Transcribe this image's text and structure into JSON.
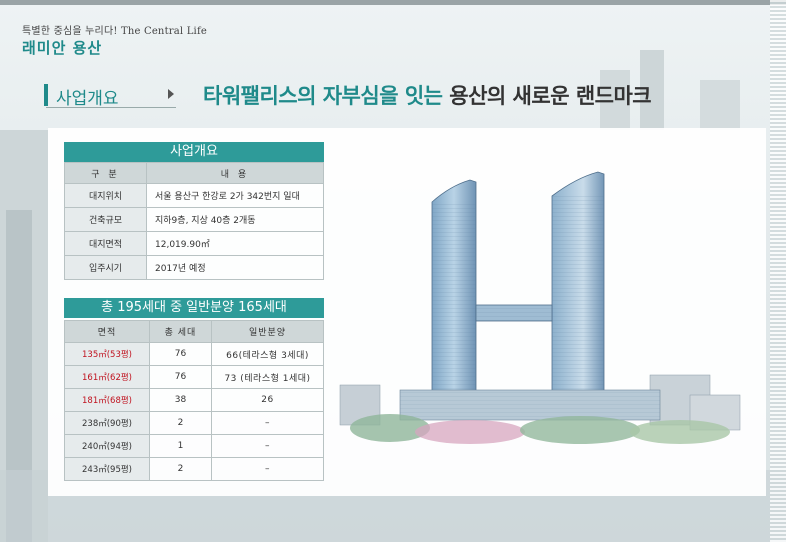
{
  "brand": {
    "tagline": "특별한 중심을 누리다! The Central Life",
    "name": "래미안 용산"
  },
  "section": {
    "label": "사업개요",
    "headline_teal": "타워팰리스의 자부심을 잇는",
    "headline_dark": "용산의 새로운 랜드마크"
  },
  "overview": {
    "title": "사업개요",
    "headers": [
      "구  분",
      "내  용"
    ],
    "rows": [
      {
        "key": "대지위치",
        "value": "서울 용산구 한강로 2가 342번지 일대"
      },
      {
        "key": "건축규모",
        "value": "지하9층, 지상 40층 2개동"
      },
      {
        "key": "대지면적",
        "value": "12,019.90㎡"
      },
      {
        "key": "입주시기",
        "value": "2017년 예정"
      }
    ]
  },
  "units": {
    "title": "총 195세대 중 일반분양 165세대",
    "headers": [
      "면적",
      "총 세대",
      "일반분양"
    ],
    "rows": [
      {
        "area": "135㎡(53평)",
        "total": "76",
        "sale": "66(테라스형 3세대)",
        "highlight": true
      },
      {
        "area": "161㎡(62평)",
        "total": "76",
        "sale": "73 (테라스형 1세대)",
        "highlight": true
      },
      {
        "area": "181㎡(68평)",
        "total": "38",
        "sale": "26",
        "highlight": true
      },
      {
        "area": "238㎡(90평)",
        "total": "2",
        "sale": "–",
        "highlight": false
      },
      {
        "area": "240㎡(94평)",
        "total": "1",
        "sale": "–",
        "highlight": false
      },
      {
        "area": "243㎡(95평)",
        "total": "2",
        "sale": "–",
        "highlight": false
      }
    ]
  },
  "colors": {
    "accent": "#1f8a8a",
    "header_bar": "#2e9b99",
    "highlight_text": "#c0131f"
  },
  "image": {
    "icon": "twin-tower-illustration"
  }
}
